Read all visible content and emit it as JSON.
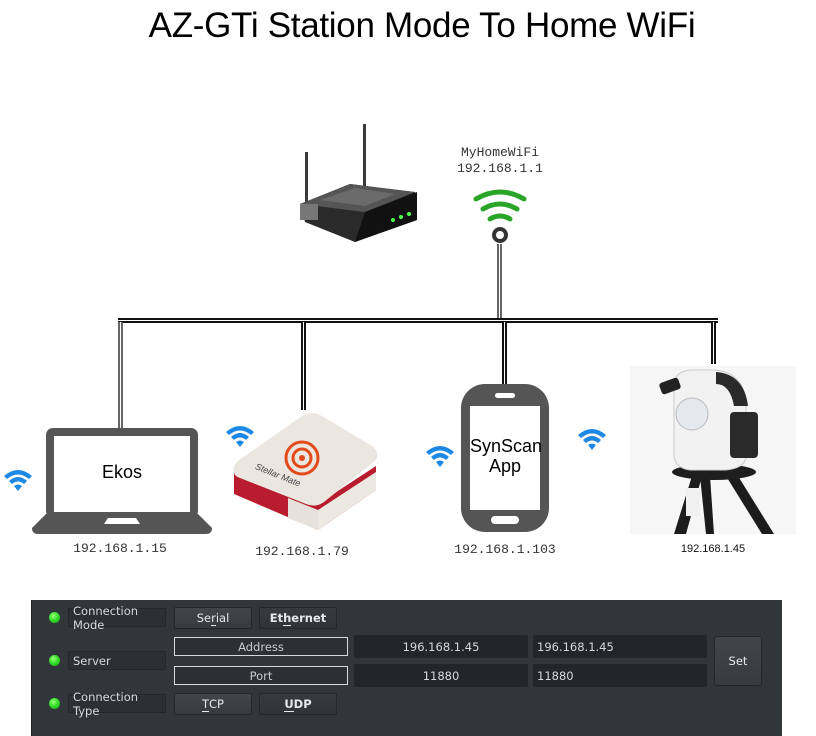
{
  "title": "AZ-GTi Station Mode To Home WiFi",
  "router": {
    "icon": "router-icon",
    "ssid": "MyHomeWiFi",
    "ip": "192.168.1.1",
    "signal_icon": "wifi-signal-icon",
    "signal_color": "#2aa52a"
  },
  "devices": [
    {
      "id": "laptop",
      "icon": "laptop-icon",
      "screen_label": "Ekos",
      "ip": "192.168.1.15",
      "wifi_color": "#1e88e5"
    },
    {
      "id": "stellarmate",
      "icon": "stellarmate-box-icon",
      "brand_label": "Stellar Mate",
      "ip": "192.168.1.79",
      "wifi_color": "#1e88e5"
    },
    {
      "id": "phone",
      "icon": "smartphone-icon",
      "screen_label_line1": "SynScan",
      "screen_label_line2": "App",
      "ip": "192.168.1.103",
      "wifi_color": "#1e88e5"
    },
    {
      "id": "mount",
      "icon": "az-gti-mount-icon",
      "ip": "192.168.1.45",
      "wifi_color": "#1e88e5"
    }
  ],
  "panel": {
    "rows": [
      {
        "label": "Connection Mode",
        "status": "connected"
      },
      {
        "label": "Server",
        "status": "connected"
      },
      {
        "label": "Connection Type",
        "status": "connected"
      }
    ],
    "connection_mode": {
      "serial_pre": "Se",
      "serial_u": "r",
      "serial_post": "ial",
      "ethernet_pre": "Et",
      "ethernet_u": "h",
      "ethernet_post": "ernet"
    },
    "server": {
      "address_label": "Address",
      "port_label": "Port",
      "address_value": "196.168.1.45",
      "address_input": "196.168.1.45",
      "port_value": "11880",
      "port_input": "11880",
      "set_label": "Set"
    },
    "connection_type": {
      "tcp_u": "T",
      "tcp_post": "CP",
      "udp_u": "U",
      "udp_post": "DP"
    },
    "led_color": "#35e02a",
    "background": "#31363b"
  }
}
